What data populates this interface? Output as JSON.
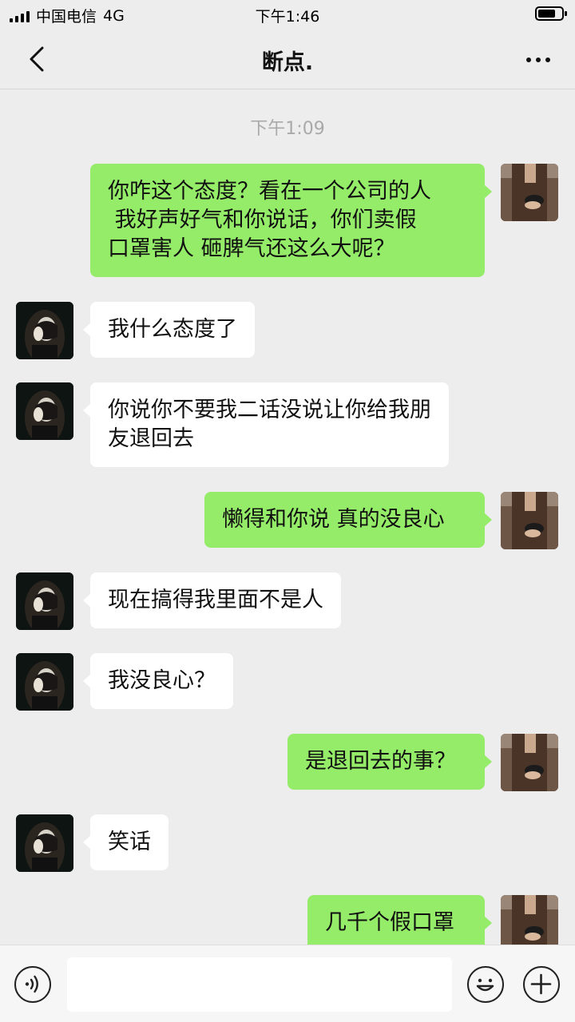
{
  "status_bar": {
    "carrier": "中国电信",
    "network": "4G",
    "time": "下午1:46",
    "battery_level": 0.75
  },
  "nav": {
    "title": "断点."
  },
  "chat": {
    "timestamp": "下午1:09",
    "messages": [
      {
        "side": "out",
        "lines": [
          "你咋这个态度？看在一个公司的人",
          " 我好声好气和你说话，你们卖假",
          "口罩害人 砸脾气还这么大呢？"
        ]
      },
      {
        "side": "in",
        "lines": [
          "我什么态度了"
        ]
      },
      {
        "side": "in",
        "lines": [
          "你说你不要我二话没说让你给我朋",
          "友退回去"
        ]
      },
      {
        "side": "out",
        "lines": [
          "懒得和你说 真的没良心"
        ]
      },
      {
        "side": "in",
        "lines": [
          "现在搞得我里面不是人"
        ]
      },
      {
        "side": "in",
        "lines": [
          "我没良心？"
        ]
      },
      {
        "side": "out",
        "lines": [
          "是退回去的事？"
        ]
      },
      {
        "side": "in",
        "lines": [
          "笑话"
        ]
      },
      {
        "side": "out",
        "lines": [
          "几千个假口罩"
        ]
      }
    ]
  },
  "input_bar": {
    "placeholder": "",
    "icons": [
      "voice-icon",
      "emoji-icon",
      "plus-icon"
    ]
  },
  "colors": {
    "background": "#ededed",
    "outgoing_bubble": "#95ec69",
    "incoming_bubble": "#ffffff",
    "timestamp_text": "#a9a9a9"
  }
}
